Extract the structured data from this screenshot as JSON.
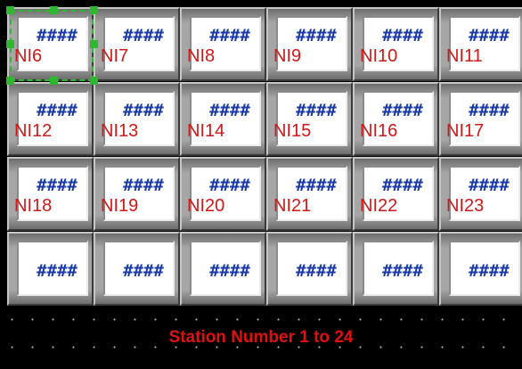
{
  "rows": [
    [
      {
        "value": "####",
        "label": "NI6"
      },
      {
        "value": "####",
        "label": "NI7"
      },
      {
        "value": "####",
        "label": "NI8"
      },
      {
        "value": "####",
        "label": "NI9"
      },
      {
        "value": "####",
        "label": "NI10"
      },
      {
        "value": "####",
        "label": "NI11"
      }
    ],
    [
      {
        "value": "####",
        "label": "NI12"
      },
      {
        "value": "####",
        "label": "NI13"
      },
      {
        "value": "####",
        "label": "NI14"
      },
      {
        "value": "####",
        "label": "NI15"
      },
      {
        "value": "####",
        "label": "NI16"
      },
      {
        "value": "####",
        "label": "NI17"
      }
    ],
    [
      {
        "value": "####",
        "label": "NI18"
      },
      {
        "value": "####",
        "label": "NI19"
      },
      {
        "value": "####",
        "label": "NI20"
      },
      {
        "value": "####",
        "label": "NI21"
      },
      {
        "value": "####",
        "label": "NI22"
      },
      {
        "value": "####",
        "label": "NI23"
      }
    ],
    [
      {
        "value": "####",
        "label": ""
      },
      {
        "value": "####",
        "label": ""
      },
      {
        "value": "####",
        "label": ""
      },
      {
        "value": "####",
        "label": ""
      },
      {
        "value": "####",
        "label": ""
      },
      {
        "value": "####",
        "label": ""
      }
    ]
  ],
  "footer": {
    "title": "Station Number 1 to 24"
  },
  "colors": {
    "value_text": "#1a3aa8",
    "label_text": "#d01818",
    "footer_text": "#e01010",
    "selection": "#2fb82f",
    "background": "#000000",
    "cell_frame": "#a6a6a6"
  },
  "selected_cell": "NI6"
}
